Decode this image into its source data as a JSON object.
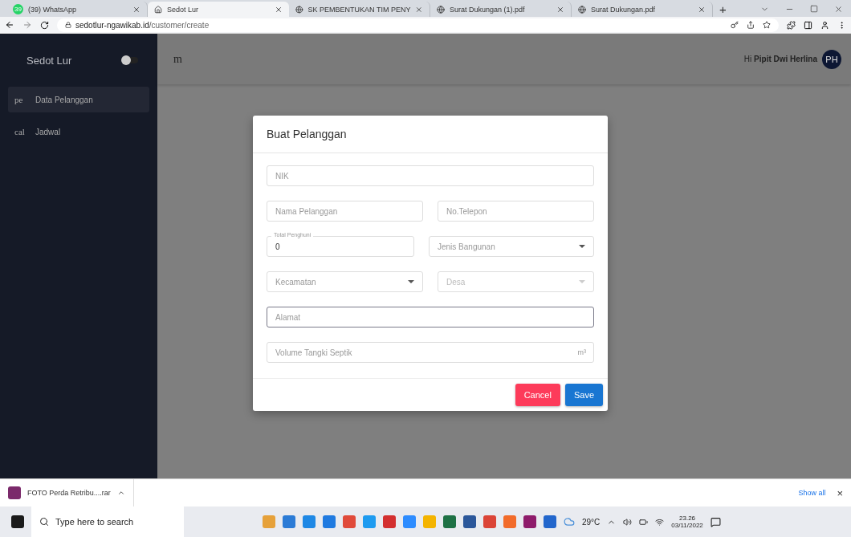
{
  "browser": {
    "tabs": [
      {
        "title": "(39) WhatsApp",
        "badge": "39",
        "selected": false
      },
      {
        "title": "Sedot Lur",
        "selected": true
      },
      {
        "title": "SK PEMBENTUKAN TIM PENY",
        "selected": false
      },
      {
        "title": "Surat Dukungan (1).pdf",
        "selected": false
      },
      {
        "title": "Surat Dukungan.pdf",
        "selected": false
      }
    ],
    "new_tab": "+",
    "url_host": "sedotlur-ngawikab.id",
    "url_path": "/customer/create"
  },
  "sidebar": {
    "title": "Sedot Lur",
    "toggle_on": false,
    "items": [
      {
        "icon_text": "pe",
        "label": "Data Pelanggan",
        "selected": true
      },
      {
        "icon_text": "cal",
        "label": "Jadwal",
        "selected": false
      }
    ]
  },
  "header": {
    "menu_text": "m",
    "greeting": "Hi",
    "user": "Pipit Dwi Herlina",
    "avatar": "PH"
  },
  "modal": {
    "title": "Buat Pelanggan",
    "rows": [
      [
        {
          "kind": "text",
          "placeholder": "NIK",
          "focused": false
        }
      ],
      [
        {
          "kind": "text",
          "placeholder": "Nama Pelanggan",
          "focused": false
        },
        {
          "kind": "text",
          "placeholder": "No.Telepon",
          "focused": false
        }
      ],
      [
        {
          "kind": "outlined",
          "label": "Total Penghuni",
          "value": "0",
          "focused": false
        },
        {
          "kind": "select",
          "placeholder": "Jenis Bangunan",
          "disabled": false
        }
      ],
      [
        {
          "kind": "select",
          "placeholder": "Kecamatan",
          "disabled": false
        },
        {
          "kind": "select",
          "placeholder": "Desa",
          "disabled": true
        }
      ],
      [
        {
          "kind": "text",
          "placeholder": "Alamat",
          "focused": true
        }
      ],
      [
        {
          "kind": "text",
          "placeholder": "Volume Tangki Septik",
          "suffix": "m³",
          "focused": false
        }
      ]
    ],
    "buttons": [
      {
        "label": "Cancel",
        "kind": "cancel"
      },
      {
        "label": "Save",
        "kind": "save"
      }
    ]
  },
  "download_bar": {
    "file": "FOTO Perda Retribu....rar",
    "show_all": "Show all",
    "close": "×"
  },
  "taskbar": {
    "search_placeholder": "Type here to search",
    "weather": "29°C",
    "time": "23.26",
    "date": "03/11/2022"
  }
}
